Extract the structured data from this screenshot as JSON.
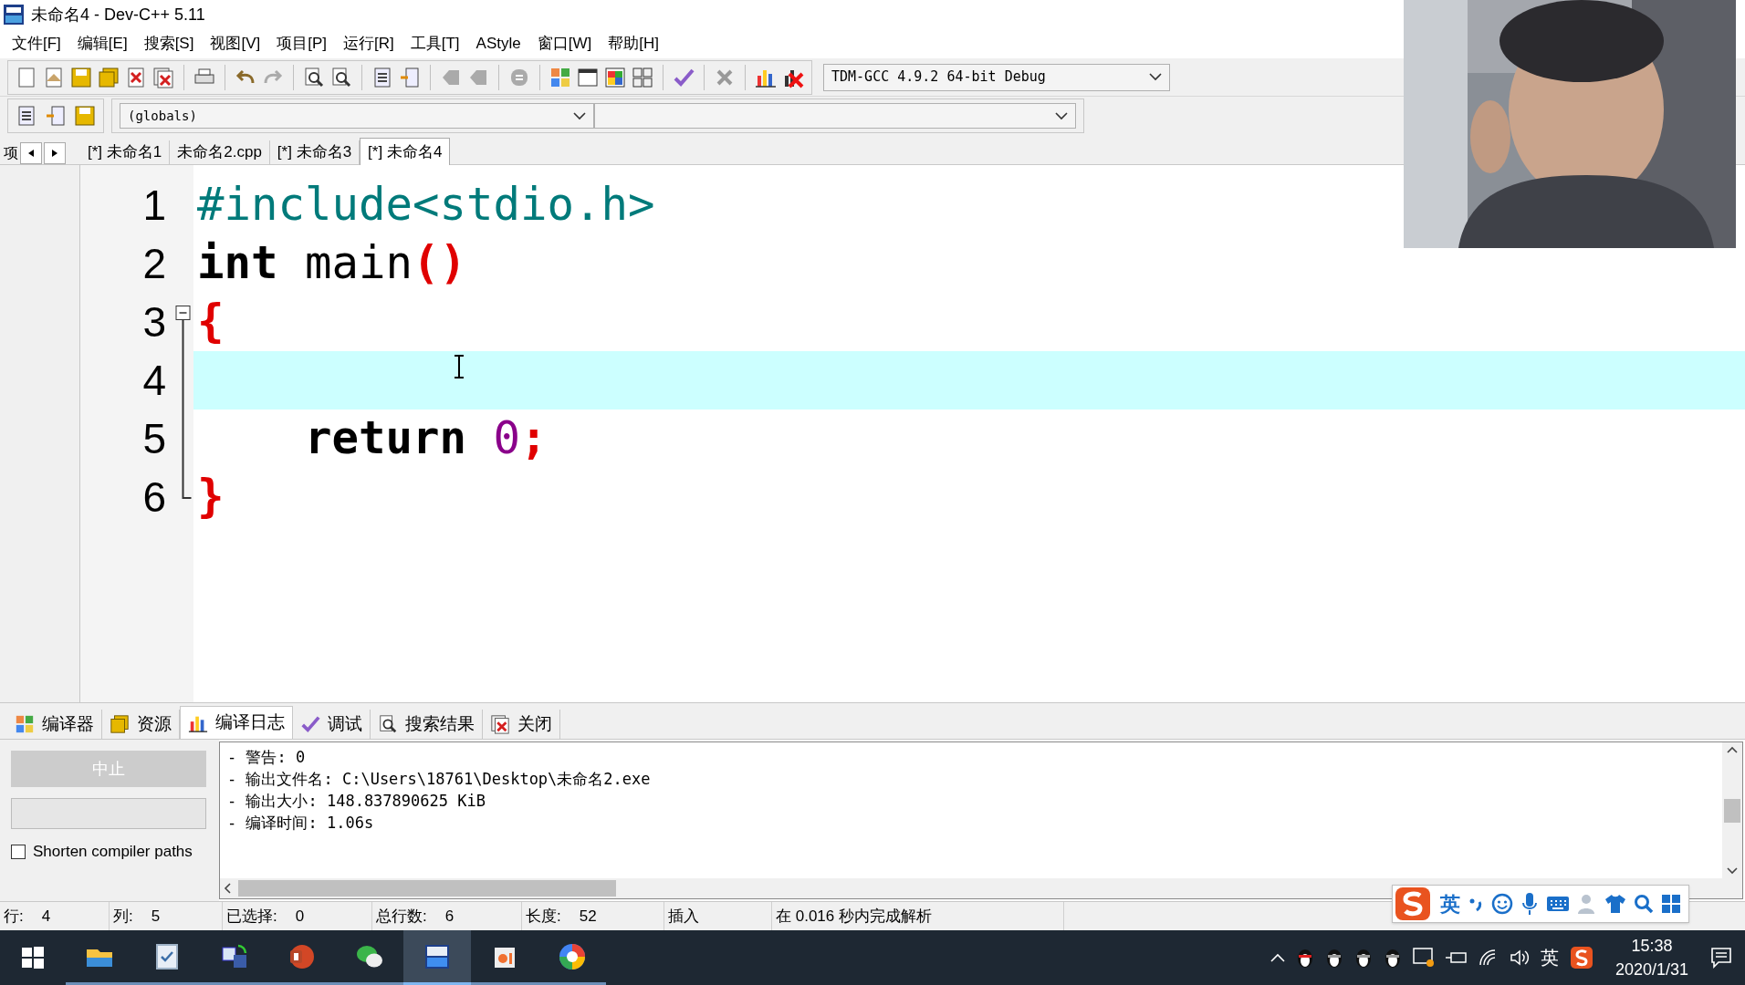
{
  "window": {
    "title": "未命名4 - Dev-C++ 5.11"
  },
  "menu": [
    "文件[F]",
    "编辑[E]",
    "搜索[S]",
    "视图[V]",
    "项目[P]",
    "运行[R]",
    "工具[T]",
    "AStyle",
    "窗口[W]",
    "帮助[H]"
  ],
  "compiler_select": {
    "value": "TDM-GCC 4.9.2 64-bit Debug"
  },
  "scope_select": {
    "value": "(globals)"
  },
  "project_panel_tab": "项",
  "file_tabs": [
    {
      "label": "[*] 未命名1",
      "selected": false
    },
    {
      "label": "未命名2.cpp",
      "selected": false
    },
    {
      "label": "[*] 未命名3",
      "selected": false
    },
    {
      "label": "[*] 未命名4",
      "selected": true
    }
  ],
  "code_lines": [
    {
      "number": "1",
      "current": false,
      "tokens": [
        {
          "kind": "preprocessor",
          "text": "#include<stdio.h>"
        }
      ]
    },
    {
      "number": "2",
      "current": false,
      "tokens": [
        {
          "kind": "keyword",
          "text": "int"
        },
        {
          "kind": "plain",
          "text": " main"
        },
        {
          "kind": "symbol",
          "text": "()"
        }
      ]
    },
    {
      "number": "3",
      "current": false,
      "tokens": [
        {
          "kind": "symbol",
          "text": "{"
        }
      ]
    },
    {
      "number": "4",
      "current": true
    },
    {
      "number": "5",
      "current": false,
      "tokens": [
        {
          "kind": "keyword",
          "text": "    return"
        },
        {
          "kind": "number",
          "text": " 0"
        },
        {
          "kind": "symbol",
          "text": ";"
        }
      ]
    },
    {
      "number": "6",
      "current": false,
      "tokens": [
        {
          "kind": "symbol",
          "text": "}"
        }
      ]
    }
  ],
  "bottom_tabs": [
    {
      "label": "编译器",
      "selected": false
    },
    {
      "label": "资源",
      "selected": false
    },
    {
      "label": "编译日志",
      "selected": true
    },
    {
      "label": "调试",
      "selected": false
    },
    {
      "label": "搜索结果",
      "selected": false
    },
    {
      "label": "关闭",
      "selected": false
    }
  ],
  "abort_button": {
    "label": "中止",
    "disabled": true
  },
  "shorten_paths": {
    "label": "Shorten compiler paths",
    "checked": false
  },
  "log_lines": [
    "- 警告: 0",
    "- 输出文件名: C:\\Users\\18761\\Desktop\\未命名2.exe",
    "- 输出大小: 148.837890625 KiB",
    "- 编译时间: 1.06s"
  ],
  "status_bar": [
    {
      "label": "行:",
      "value": "4"
    },
    {
      "label": "列:",
      "value": "5"
    },
    {
      "label": "已选择:",
      "value": "0"
    },
    {
      "label": "总行数:",
      "value": "6"
    },
    {
      "label": "长度:",
      "value": "52"
    },
    {
      "label": "插入"
    },
    {
      "label": "在 0.016 秒内完成解析"
    }
  ],
  "build_progress": {
    "level": 0
  },
  "ime_bar": {
    "mode": "英"
  },
  "taskbar": {
    "apps": [
      {
        "kind": "explorer",
        "selected": false
      },
      {
        "kind": "notes",
        "selected": false
      },
      {
        "kind": "translate",
        "selected": false
      },
      {
        "kind": "slides",
        "selected": false
      },
      {
        "kind": "chat",
        "selected": false
      },
      {
        "kind": "devcpp",
        "selected": true
      },
      {
        "kind": "camera",
        "selected": false
      },
      {
        "kind": "pinwheel",
        "selected": false
      }
    ],
    "tray_ime": "英",
    "clock_time": "15:38",
    "clock_date": "2020/1/31"
  }
}
